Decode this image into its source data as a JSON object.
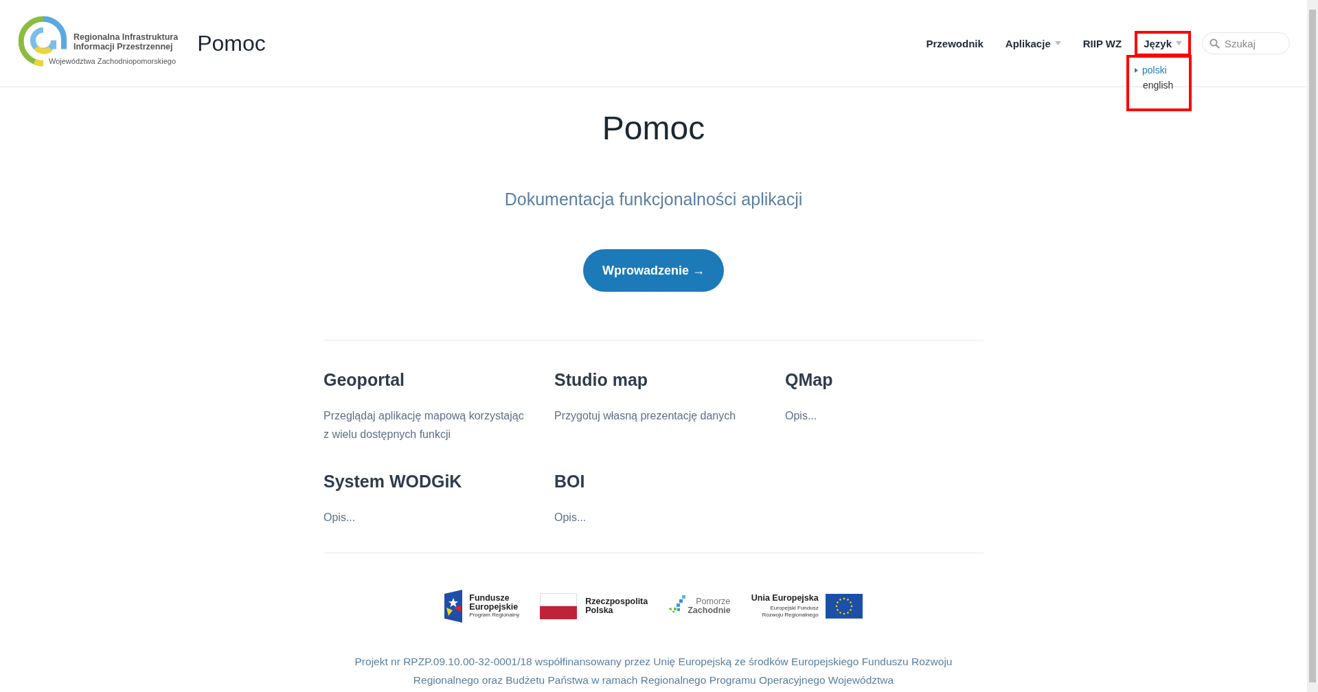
{
  "header": {
    "logo": {
      "line_1": "Regionalna Infrastruktura",
      "line_2": "Informacji Przestrzennej",
      "line_3": "Województwa Zachodniopomorskiego"
    },
    "site_title": "Pomoc",
    "nav": [
      {
        "label": "Przewodnik",
        "kind": "link",
        "highlighted": false
      },
      {
        "label": "Aplikacje",
        "kind": "menu",
        "highlighted": false
      },
      {
        "label": "RIIP WZ",
        "kind": "link",
        "highlighted": false
      },
      {
        "label": "Język",
        "kind": "menu",
        "highlighted": true
      }
    ],
    "search": {
      "placeholder": "Szukaj"
    },
    "language_menu": {
      "highlighted": true,
      "items": [
        {
          "label": "polski",
          "selected": true
        },
        {
          "label": "english",
          "selected": false
        }
      ]
    }
  },
  "hero": {
    "title": "Pomoc",
    "subtitle": "Dokumentacja funkcjonalności aplikacji",
    "button": "Wprowadzenie →"
  },
  "apps": [
    {
      "title": "Geoportal",
      "description": "Przeglądaj aplikację mapową korzystając z wielu dostępnych funkcji"
    },
    {
      "title": "Studio map",
      "description": "Przygotuj własną prezentację danych"
    },
    {
      "title": "QMap",
      "description": "Opis..."
    },
    {
      "title": "System WODGiK",
      "description": "Opis..."
    },
    {
      "title": "BOI",
      "description": "Opis..."
    }
  ],
  "footer": {
    "logos": [
      {
        "kind": "eu-funds",
        "lines": [
          "Fundusze",
          "Europejskie",
          "Program Regionalny"
        ]
      },
      {
        "kind": "poland",
        "lines": [
          "Rzeczpospolita",
          "Polska"
        ]
      },
      {
        "kind": "region",
        "lines": [
          "Pomorze",
          "Zachodnie"
        ]
      },
      {
        "kind": "eu",
        "lines": [
          "Unia Europejska",
          "Europejski Fundusz",
          "Rozwoju Regionalnego"
        ]
      }
    ],
    "note": "Projekt nr RPZP.09.10.00-32-0001/18 współfinansowany przez Unię Europejską ze środków Europejskiego Funduszu Rozwoju Regionalnego oraz Budżetu Państwa w ramach Regionalnego Programu Operacyjnego Województwa"
  }
}
